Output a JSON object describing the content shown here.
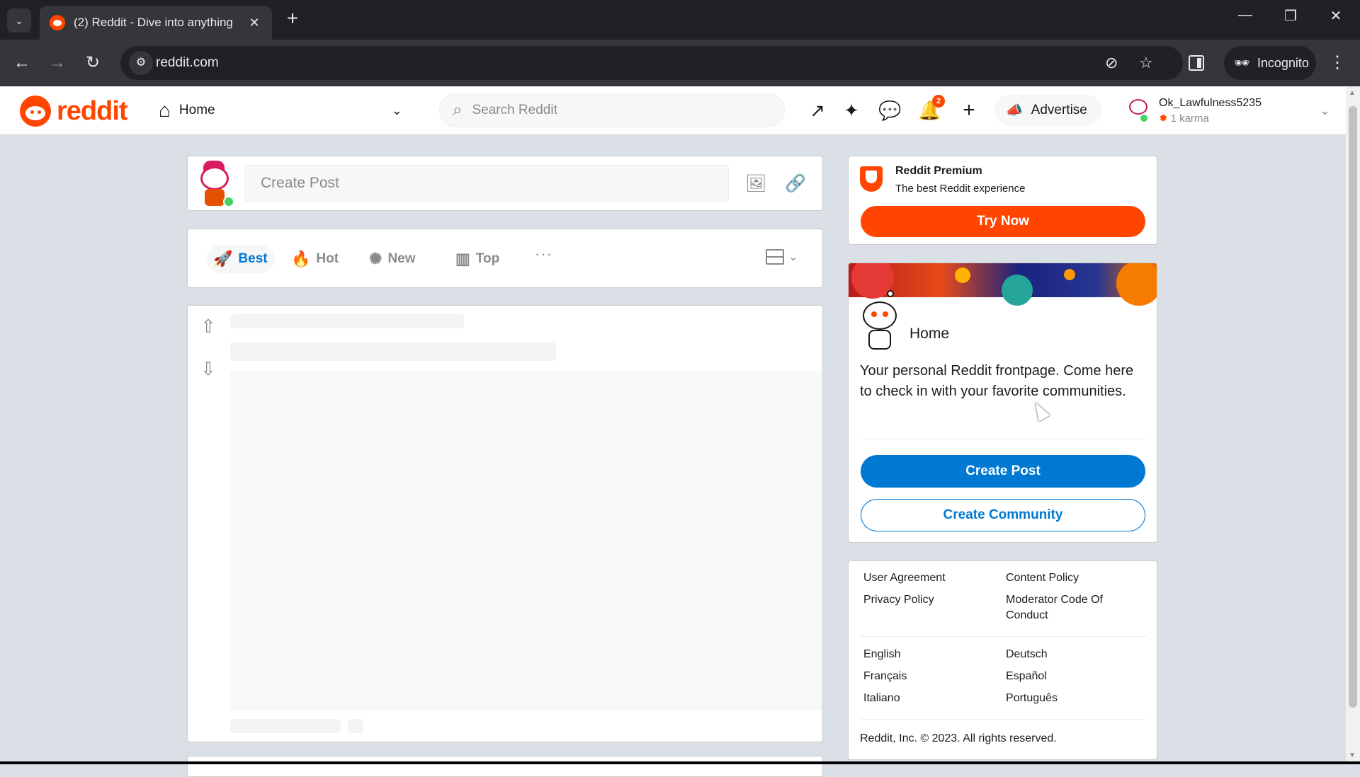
{
  "browser": {
    "tab_title": "(2) Reddit - Dive into anything",
    "url": "reddit.com",
    "incognito_label": "Incognito"
  },
  "header": {
    "logo_text": "reddit",
    "feed_selector": "Home",
    "search_placeholder": "Search Reddit",
    "notification_count": "2",
    "advertise_label": "Advertise",
    "username": "Ok_Lawfulness5235",
    "karma": "1 karma"
  },
  "create_post": {
    "placeholder": "Create Post"
  },
  "sort": {
    "best": "Best",
    "hot": "Hot",
    "new": "New",
    "top": "Top",
    "more": "···"
  },
  "premium": {
    "title": "Reddit Premium",
    "subtitle": "The best Reddit experience",
    "cta": "Try Now"
  },
  "home_card": {
    "title": "Home",
    "description": "Your personal Reddit frontpage. Come here to check in with your favorite communities.",
    "create_post": "Create Post",
    "create_community": "Create Community"
  },
  "footer": {
    "links": {
      "user_agreement": "User Agreement",
      "content_policy": "Content Policy",
      "privacy_policy": "Privacy Policy",
      "moderator_code": "Moderator Code Of Conduct"
    },
    "languages": {
      "english": "English",
      "deutsch": "Deutsch",
      "francais": "Français",
      "espanol": "Español",
      "italiano": "Italiano",
      "portugues": "Português"
    },
    "copyright": "Reddit, Inc. © 2023. All rights reserved."
  },
  "colors": {
    "brand_orange": "#ff4500",
    "brand_blue": "#0079d3",
    "page_bg": "#dae0e6"
  }
}
